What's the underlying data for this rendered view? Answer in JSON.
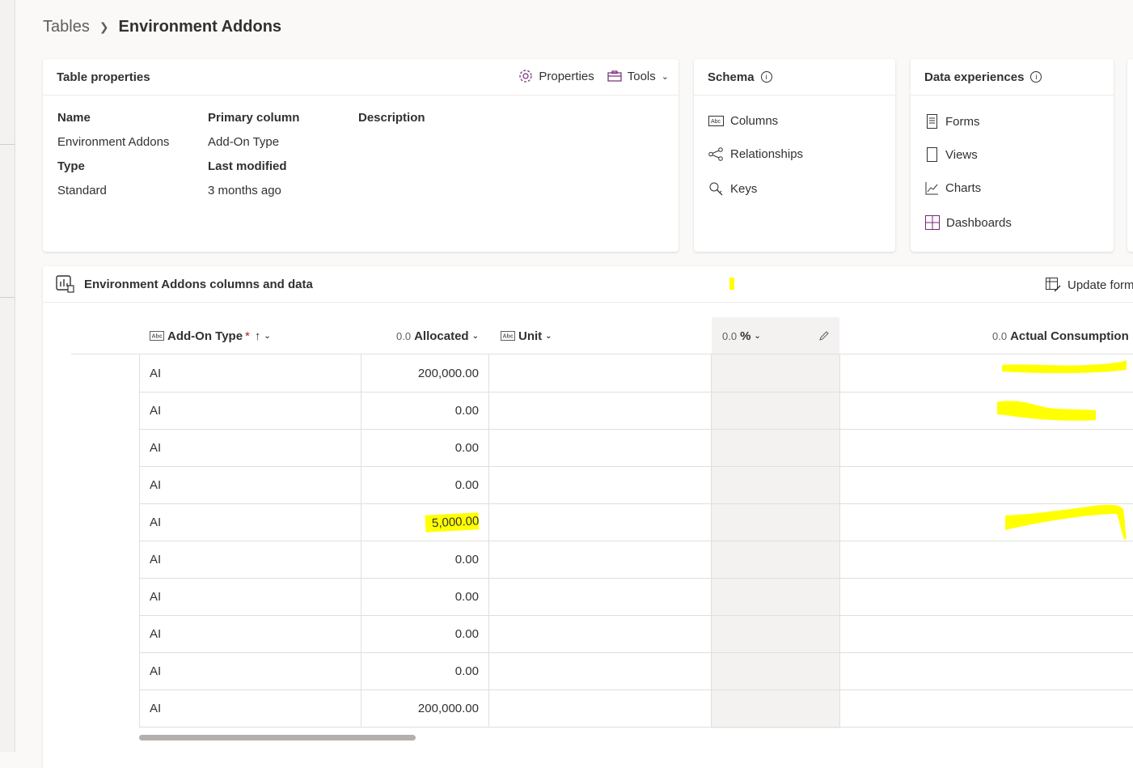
{
  "breadcrumb": {
    "parent": "Tables",
    "current": "Environment Addons"
  },
  "table_properties": {
    "title": "Table properties",
    "properties_button": "Properties",
    "tools_button": "Tools",
    "fields": {
      "name_label": "Name",
      "name_value": "Environment Addons",
      "primary_label": "Primary column",
      "primary_value": "Add-On Type",
      "description_label": "Description",
      "type_label": "Type",
      "type_value": "Standard",
      "modified_label": "Last modified",
      "modified_value": "3 months ago"
    }
  },
  "schema": {
    "title": "Schema",
    "items": [
      {
        "label": "Columns",
        "icon": "columns-icon"
      },
      {
        "label": "Relationships",
        "icon": "relationships-icon"
      },
      {
        "label": "Keys",
        "icon": "keys-icon"
      }
    ]
  },
  "data_experiences": {
    "title": "Data experiences",
    "items": [
      {
        "label": "Forms",
        "icon": "forms-icon"
      },
      {
        "label": "Views",
        "icon": "views-icon"
      },
      {
        "label": "Charts",
        "icon": "charts-icon"
      },
      {
        "label": "Dashboards",
        "icon": "dashboards-icon"
      }
    ]
  },
  "grid": {
    "title": "Environment Addons columns and data",
    "update_forms": "Update form",
    "columns": [
      {
        "label": "Add-On Type",
        "type_glyph": "Abc",
        "required": "*",
        "sort": "↑"
      },
      {
        "label": "Allocated",
        "type_glyph": "0.0"
      },
      {
        "label": "Unit",
        "type_glyph": "Abc"
      },
      {
        "label": "%",
        "type_glyph": "0.0"
      },
      {
        "label": "Actual Consumption",
        "type_glyph": "0.0"
      }
    ],
    "rows": [
      {
        "type": "AI",
        "allocated": "200,000.00"
      },
      {
        "type": "AI",
        "allocated": "0.00"
      },
      {
        "type": "AI",
        "allocated": "0.00"
      },
      {
        "type": "AI",
        "allocated": "0.00"
      },
      {
        "type": "AI",
        "allocated": "5,000.00",
        "highlight": true
      },
      {
        "type": "AI",
        "allocated": "0.00"
      },
      {
        "type": "AI",
        "allocated": "0.00"
      },
      {
        "type": "AI",
        "allocated": "0.00"
      },
      {
        "type": "AI",
        "allocated": "0.00"
      },
      {
        "type": "AI",
        "allocated": "200,000.00"
      }
    ]
  },
  "colors": {
    "accent": "#742774",
    "highlight": "#ffff00",
    "pct_column_bg": "#f3f2f1"
  }
}
